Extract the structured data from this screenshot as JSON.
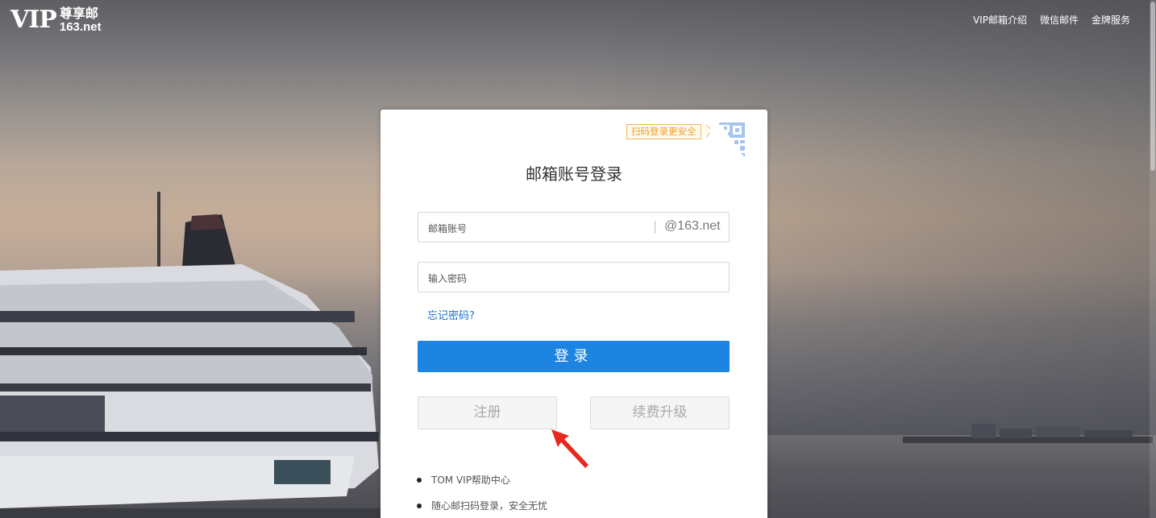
{
  "header": {
    "logo": {
      "vip": "VIP",
      "zh": "尊享邮",
      "domain": "163.net"
    },
    "nav": [
      "VIP邮箱介绍",
      "微信邮件",
      "金牌服务"
    ]
  },
  "login": {
    "qr_tag": "扫码登录更安全",
    "title": "邮箱账号登录",
    "account_placeholder": "邮箱账号",
    "domain_suffix": "@163.net",
    "password_placeholder": "输入密码",
    "forgot": "忘记密码?",
    "login_button": "登录",
    "register_button": "注册",
    "renew_button": "续费升级",
    "tips": [
      "TOM VIP帮助中心",
      "随心邮扫码登录，安全无忧"
    ]
  },
  "colors": {
    "primary": "#1d84e2",
    "link": "#1a6fc4",
    "qr_tag": "#f0a020",
    "annotation_arrow": "#e8281e"
  }
}
